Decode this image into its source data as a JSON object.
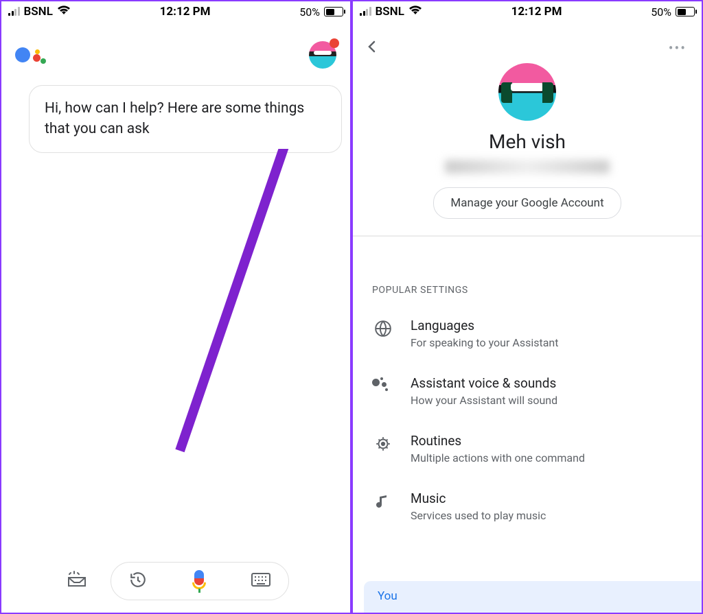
{
  "statusbar": {
    "carrier": "BSNL",
    "time": "12:12 PM",
    "battery": "50%"
  },
  "screen1": {
    "assistant_greeting": "Hi, how can I help? Here are some things that you can ask"
  },
  "screen2": {
    "profile": {
      "name": "Meh vish",
      "manage_label": "Manage your Google Account"
    },
    "section_label": "POPULAR SETTINGS",
    "settings": [
      {
        "title": "Languages",
        "sub": "For speaking to your Assistant"
      },
      {
        "title": "Assistant voice & sounds",
        "sub": "How your Assistant will sound"
      },
      {
        "title": "Routines",
        "sub": "Multiple actions with one command"
      },
      {
        "title": "Music",
        "sub": "Services used to play music"
      }
    ],
    "you_label": "You"
  }
}
